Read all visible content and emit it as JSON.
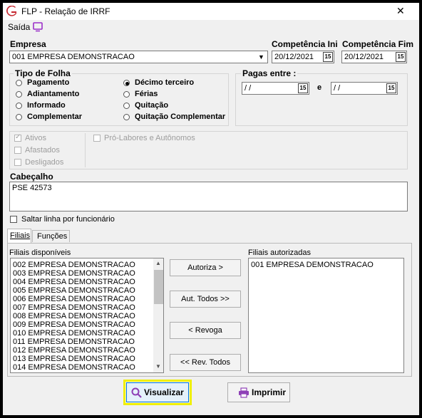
{
  "window": {
    "title": "FLP - Relação de IRRF",
    "close_glyph": "✕"
  },
  "menu": {
    "saida": "Saída"
  },
  "empresa": {
    "label": "Empresa",
    "value": "001 EMPRESA DEMONSTRACAO"
  },
  "competencia_ini": {
    "label": "Competência Ini",
    "value": "20/12/2021"
  },
  "competencia_fim": {
    "label": "Competência Fim",
    "value": "20/12/2021"
  },
  "calendar_icon_text": "15",
  "tipo_folha": {
    "label": "Tipo de Folha",
    "options": [
      "Pagamento",
      "Adiantamento",
      "Informado",
      "Complementar",
      "Décimo terceiro",
      "Férias",
      "Quitação",
      "Quitação Complementar"
    ],
    "selected": "Décimo terceiro"
  },
  "pagas_entre": {
    "label": "Pagas entre :",
    "from": " / /",
    "to": " / /",
    "connector": "e"
  },
  "situacao": {
    "ativos": "Ativos",
    "afastados": "Afastados",
    "desligados": "Desligados",
    "pro_labores": "Pró-Labores e Autônomos"
  },
  "cabecalho": {
    "label": "Cabeçalho",
    "value": "PSE 42573"
  },
  "saltar_linha": "Saltar linha por funcionário",
  "tabs": [
    {
      "label": "Filiais"
    },
    {
      "label": "Funções"
    }
  ],
  "filiais_disponiveis": {
    "label": "Filiais disponíveis",
    "items": [
      "002 EMPRESA DEMONSTRACAO",
      "003 EMPRESA DEMONSTRACAO",
      "004 EMPRESA DEMONSTRACAO",
      "005 EMPRESA DEMONSTRACAO",
      "006 EMPRESA DEMONSTRACAO",
      "007 EMPRESA DEMONSTRACAO",
      "008 EMPRESA DEMONSTRACAO",
      "009 EMPRESA DEMONSTRACAO",
      "010 EMPRESA DEMONSTRACAO",
      "011 EMPRESA DEMONSTRACAO",
      "012 EMPRESA DEMONSTRACAO",
      "013 EMPRESA DEMONSTRACAO",
      "014 EMPRESA DEMONSTRACAO"
    ]
  },
  "filiais_autorizadas": {
    "label": "Filiais autorizadas",
    "items": [
      "001 EMPRESA DEMONSTRACAO"
    ]
  },
  "buttons": {
    "autoriza": "Autoriza >",
    "aut_todos": "Aut. Todos >>",
    "revoga": "< Revoga",
    "rev_todos": "<< Rev. Todos",
    "visualizar": "Visualizar",
    "imprimir": "Imprimir"
  },
  "colors": {
    "highlight": "#f0f000",
    "app_icon": "#c6262e",
    "monitor_icon": "#9b2fc9",
    "printer_icon": "#8e3fb6"
  }
}
